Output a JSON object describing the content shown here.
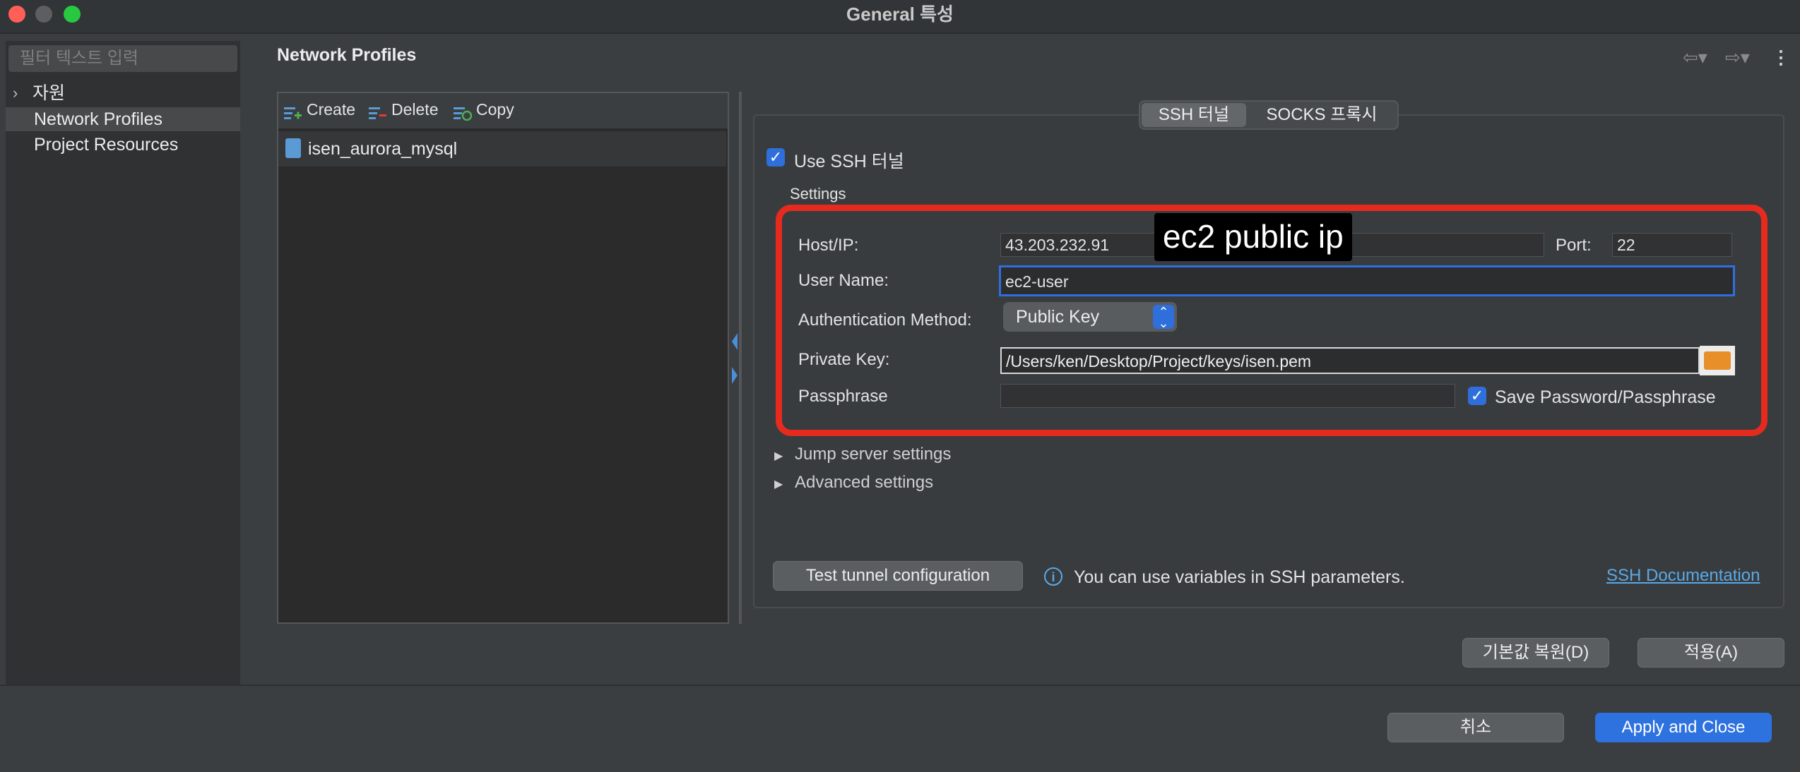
{
  "window": {
    "title": "General 특성"
  },
  "sidebar": {
    "filter_placeholder": "필터 텍스트 입력",
    "items": [
      {
        "label": "자원",
        "chevron": "chevron-right-icon"
      },
      {
        "label": "Network Profiles"
      },
      {
        "label": "Project Resources"
      }
    ]
  },
  "page": {
    "title": "Network Profiles"
  },
  "profiles_toolbar": {
    "create": "Create",
    "delete": "Delete",
    "copy": "Copy"
  },
  "profiles": [
    {
      "name": "isen_aurora_mysql"
    }
  ],
  "tabs": [
    {
      "label": "SSH 터널",
      "active": true
    },
    {
      "label": "SOCKS 프록시",
      "active": false
    }
  ],
  "ssh": {
    "use_ssh_label": "Use SSH 터널",
    "use_ssh_checked": true,
    "settings_label": "Settings",
    "host_label": "Host/IP:",
    "host_value": "43.203.232.91",
    "port_label": "Port:",
    "port_value": "22",
    "user_label": "User Name:",
    "user_value": "ec2-user",
    "auth_label": "Authentication Method:",
    "auth_value": "Public Key",
    "key_label": "Private Key:",
    "key_value": "/Users/ken/Desktop/Project/keys/isen.pem",
    "passphrase_label": "Passphrase",
    "passphrase_value": "",
    "save_password_label": "Save Password/Passphrase",
    "save_password_checked": true,
    "jump_server_label": "Jump server settings",
    "advanced_label": "Advanced settings",
    "test_button": "Test tunnel configuration",
    "info_text": "You can use variables in SSH parameters.",
    "doc_link": "SSH Documentation"
  },
  "annotation": {
    "caption": "ec2 public ip",
    "highlight_color": "#e62b1e"
  },
  "buttons": {
    "restore_defaults": "기본값 복원(D)",
    "apply": "적용(A)",
    "cancel": "취소",
    "apply_and_close": "Apply and Close"
  },
  "colors": {
    "accent": "#2e72e0",
    "link": "#5aa9e6",
    "background": "#3b3e41"
  }
}
